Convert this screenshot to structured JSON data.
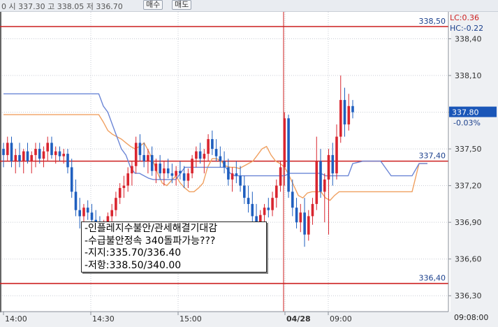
{
  "toolbar": {
    "quote_text": "0 시 337.30 고 338.05 저 336.70",
    "buy_label": "매수",
    "sell_label": "매도"
  },
  "indicators": {
    "lc": "LC:0.36",
    "hc": "HC:-0.22"
  },
  "current": {
    "price": "337.80",
    "change": "-0.03%"
  },
  "annotation": {
    "lines": [
      "-인플레지수불안/관세해결기대감",
      "-수급불안정속 340돌파가능???",
      "-지지:335.70/336.40",
      "-저항:338.50/340.00"
    ]
  },
  "status": {
    "time": "09:08:00"
  },
  "colors": {
    "up": "#d9252f",
    "down": "#1f5fbf",
    "orange_line": "#f0a060",
    "blue_line": "#6b86d6",
    "level_line": "#cc1f1f",
    "current_box": "#1a56b8"
  },
  "chart_data": {
    "type": "candlestick",
    "y_ticks": [
      "338,40",
      "338,10",
      "337,80",
      "337,50",
      "337,20",
      "336,90",
      "336,60",
      "336,30"
    ],
    "ylim": [
      336.17,
      338.62
    ],
    "x_ticks": [
      "14:00",
      "14:30",
      "15:00",
      "04/28",
      "09:00"
    ],
    "level_lines": [
      {
        "value": 338.5,
        "label": "338,50"
      },
      {
        "value": 337.4,
        "label": "337,40"
      },
      {
        "value": 336.4,
        "label": "336,40"
      }
    ],
    "ohlc": [
      [
        337.5,
        337.55,
        337.35,
        337.45
      ],
      [
        337.45,
        337.6,
        337.4,
        337.55
      ],
      [
        337.55,
        337.6,
        337.35,
        337.4
      ],
      [
        337.4,
        337.5,
        337.3,
        337.45
      ],
      [
        337.45,
        337.55,
        337.35,
        337.4
      ],
      [
        337.4,
        337.5,
        337.3,
        337.48
      ],
      [
        337.48,
        337.55,
        337.38,
        337.4
      ],
      [
        337.4,
        337.48,
        337.3,
        337.45
      ],
      [
        337.45,
        337.55,
        337.35,
        337.5
      ],
      [
        337.5,
        337.55,
        337.38,
        337.42
      ],
      [
        337.42,
        337.52,
        337.35,
        337.48
      ],
      [
        337.48,
        337.6,
        337.4,
        337.55
      ],
      [
        337.55,
        337.6,
        337.42,
        337.45
      ],
      [
        337.45,
        337.52,
        337.38,
        337.48
      ],
      [
        337.48,
        337.52,
        337.4,
        337.44
      ],
      [
        337.44,
        337.5,
        337.38,
        337.46
      ],
      [
        337.46,
        337.5,
        337.3,
        337.35
      ],
      [
        337.35,
        337.42,
        337.1,
        337.15
      ],
      [
        337.15,
        337.25,
        336.95,
        337.0
      ],
      [
        337.0,
        337.1,
        336.85,
        336.95
      ],
      [
        336.95,
        337.05,
        336.85,
        337.02
      ],
      [
        337.02,
        337.08,
        336.92,
        336.98
      ],
      [
        336.98,
        337.05,
        336.85,
        336.92
      ],
      [
        336.92,
        337.0,
        336.8,
        336.86
      ],
      [
        336.86,
        336.95,
        336.75,
        336.8
      ],
      [
        336.8,
        336.92,
        336.72,
        336.88
      ],
      [
        336.88,
        336.98,
        336.82,
        336.95
      ],
      [
        336.95,
        337.05,
        336.9,
        337.0
      ],
      [
        337.0,
        337.15,
        336.95,
        337.1
      ],
      [
        337.1,
        337.22,
        337.05,
        337.18
      ],
      [
        337.18,
        337.28,
        337.1,
        337.2
      ],
      [
        337.2,
        337.35,
        337.15,
        337.3
      ],
      [
        337.3,
        337.4,
        337.2,
        337.36
      ],
      [
        337.36,
        337.6,
        337.3,
        337.55
      ],
      [
        337.55,
        337.62,
        337.4,
        337.45
      ],
      [
        337.45,
        337.55,
        337.35,
        337.4
      ],
      [
        337.4,
        337.5,
        337.3,
        337.45
      ],
      [
        337.45,
        337.52,
        337.28,
        337.32
      ],
      [
        337.32,
        337.42,
        337.22,
        337.38
      ],
      [
        337.38,
        337.45,
        337.25,
        337.3
      ],
      [
        337.3,
        337.4,
        337.2,
        337.34
      ],
      [
        337.34,
        337.42,
        337.26,
        337.3
      ],
      [
        337.3,
        337.38,
        337.22,
        337.28
      ],
      [
        337.28,
        337.36,
        337.2,
        337.32
      ],
      [
        337.32,
        337.4,
        337.25,
        337.3
      ],
      [
        337.3,
        337.36,
        337.18,
        337.24
      ],
      [
        337.24,
        337.34,
        337.18,
        337.3
      ],
      [
        337.3,
        337.45,
        337.26,
        337.42
      ],
      [
        337.42,
        337.52,
        337.35,
        337.48
      ],
      [
        337.48,
        337.55,
        337.38,
        337.42
      ],
      [
        337.42,
        337.5,
        337.3,
        337.46
      ],
      [
        337.46,
        337.62,
        337.4,
        337.58
      ],
      [
        337.58,
        337.65,
        337.45,
        337.5
      ],
      [
        337.5,
        337.58,
        337.4,
        337.44
      ],
      [
        337.44,
        337.52,
        337.35,
        337.4
      ],
      [
        337.4,
        337.48,
        337.3,
        337.35
      ],
      [
        337.35,
        337.42,
        337.2,
        337.25
      ],
      [
        337.25,
        337.35,
        337.15,
        337.3
      ],
      [
        337.3,
        337.4,
        337.22,
        337.28
      ],
      [
        337.28,
        337.36,
        337.15,
        337.2
      ],
      [
        337.2,
        337.28,
        337.05,
        337.1
      ],
      [
        337.1,
        337.2,
        336.98,
        337.05
      ],
      [
        337.05,
        337.15,
        336.9,
        336.95
      ],
      [
        336.95,
        337.05,
        336.85,
        336.9
      ],
      [
        336.9,
        337.0,
        336.8,
        336.96
      ],
      [
        336.96,
        337.05,
        336.88,
        337.02
      ],
      [
        337.02,
        337.1,
        336.94,
        337.0
      ],
      [
        337.0,
        337.15,
        336.95,
        337.1
      ],
      [
        337.1,
        337.25,
        337.02,
        337.2
      ],
      [
        337.2,
        337.4,
        337.15,
        337.35
      ],
      [
        337.35,
        337.8,
        337.2,
        337.75
      ],
      [
        337.75,
        337.78,
        337.1,
        337.15
      ],
      [
        337.15,
        337.25,
        336.95,
        337.02
      ],
      [
        337.02,
        337.1,
        336.85,
        336.9
      ],
      [
        336.9,
        337.05,
        336.82,
        336.98
      ],
      [
        336.98,
        337.1,
        336.7,
        336.8
      ],
      [
        336.8,
        337.0,
        336.75,
        336.95
      ],
      [
        336.95,
        337.1,
        336.88,
        337.05
      ],
      [
        337.05,
        337.6,
        337.0,
        337.4
      ],
      [
        337.4,
        337.5,
        337.1,
        337.15
      ],
      [
        337.15,
        337.3,
        336.9,
        337.25
      ],
      [
        337.25,
        337.5,
        336.8,
        337.45
      ],
      [
        337.45,
        337.55,
        337.2,
        337.3
      ],
      [
        337.3,
        337.7,
        337.25,
        337.6
      ],
      [
        337.6,
        338.1,
        337.55,
        337.9
      ],
      [
        337.9,
        338.0,
        337.6,
        337.7
      ],
      [
        337.7,
        337.95,
        337.65,
        337.85
      ],
      [
        337.85,
        337.9,
        337.75,
        337.8
      ]
    ],
    "orange_series": [
      337.78,
      337.78,
      337.78,
      337.78,
      337.78,
      337.78,
      337.78,
      337.78,
      337.78,
      337.78,
      337.78,
      337.78,
      337.78,
      337.78,
      337.78,
      337.78,
      337.78,
      337.78,
      337.78,
      337.78,
      337.78,
      337.78,
      337.72,
      337.65,
      337.62,
      337.6,
      337.58,
      337.55,
      337.52,
      337.5,
      337.52,
      337.55,
      337.48,
      337.4,
      337.3,
      337.22,
      337.2,
      337.24,
      337.28,
      337.22,
      337.18,
      337.15,
      337.15,
      337.18,
      337.22,
      337.35,
      337.42,
      337.42,
      337.4,
      337.36,
      337.35,
      337.35,
      337.34,
      337.36,
      337.38,
      337.4,
      337.45,
      337.5,
      337.52,
      337.45,
      337.4,
      337.38,
      337.35,
      337.28,
      337.2,
      337.12,
      337.1,
      337.14,
      337.15,
      337.15,
      337.15,
      337.1,
      337.08,
      337.12,
      337.15,
      337.15,
      337.15,
      337.15
    ],
    "blue_series": [
      337.95,
      337.95,
      337.95,
      337.95,
      337.95,
      337.95,
      337.95,
      337.95,
      337.95,
      337.95,
      337.95,
      337.95,
      337.95,
      337.95,
      337.95,
      337.95,
      337.95,
      337.95,
      337.95,
      337.95,
      337.95,
      337.95,
      337.85,
      337.8,
      337.7,
      337.6,
      337.5,
      337.45,
      337.35,
      337.3,
      337.3,
      337.28,
      337.26,
      337.25,
      337.25,
      337.25,
      337.25,
      337.25,
      337.25,
      337.3,
      337.35,
      337.35,
      337.35,
      337.35,
      337.35,
      337.35,
      337.35,
      337.35,
      337.35,
      337.35,
      337.3,
      337.28,
      337.28,
      337.28,
      337.28,
      337.28,
      337.28,
      337.28,
      337.28,
      337.28,
      337.28,
      337.28,
      337.28,
      337.3,
      337.3,
      337.3,
      337.3,
      337.3,
      337.3,
      337.3,
      337.3,
      337.28,
      337.28,
      337.28,
      337.28,
      337.28,
      337.28,
      337.38
    ]
  }
}
